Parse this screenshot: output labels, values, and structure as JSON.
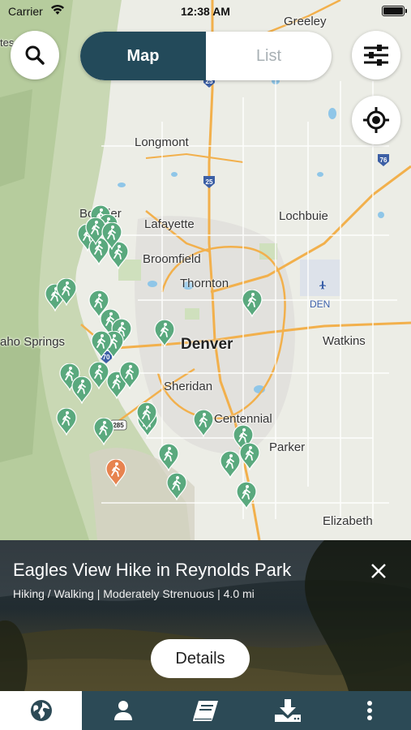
{
  "status_bar": {
    "carrier": "Carrier",
    "time": "12:38 AM"
  },
  "view_toggle": {
    "map_label": "Map",
    "list_label": "List",
    "active": "Map"
  },
  "map": {
    "cities": {
      "greeley": "Greeley",
      "longmont": "Longmont",
      "boulder": "Boulder",
      "lafayette": "Lafayette",
      "lochbuie": "Lochbuie",
      "broomfield": "Broomfield",
      "thornton": "Thornton",
      "den": "DEN",
      "denver": "Denver",
      "watkins": "Watkins",
      "springs": "aho Springs",
      "sheridan": "Sheridan",
      "centennial": "Centennial",
      "parker": "Parker",
      "elizabeth": "Elizabeth",
      "edge_tes": "tes"
    },
    "highway_shields": {
      "i25_north": "25",
      "i25_mid": "25",
      "i76": "76",
      "i70": "70",
      "us285": "285"
    },
    "colors": {
      "pin_default": "#5aa97e",
      "pin_selected": "#e7834f"
    }
  },
  "selected_trail": {
    "title": "Eagles View Hike in Reynolds Park",
    "subtitle": "Hiking / Walking | Moderately Strenuous | 4.0 mi",
    "details_label": "Details"
  },
  "tab_bar": {
    "items": [
      {
        "icon": "globe-icon",
        "active": true
      },
      {
        "icon": "person-icon",
        "active": false
      },
      {
        "icon": "book-icon",
        "active": false
      },
      {
        "icon": "download-icon",
        "active": false
      },
      {
        "icon": "more-icon",
        "active": false
      }
    ]
  }
}
